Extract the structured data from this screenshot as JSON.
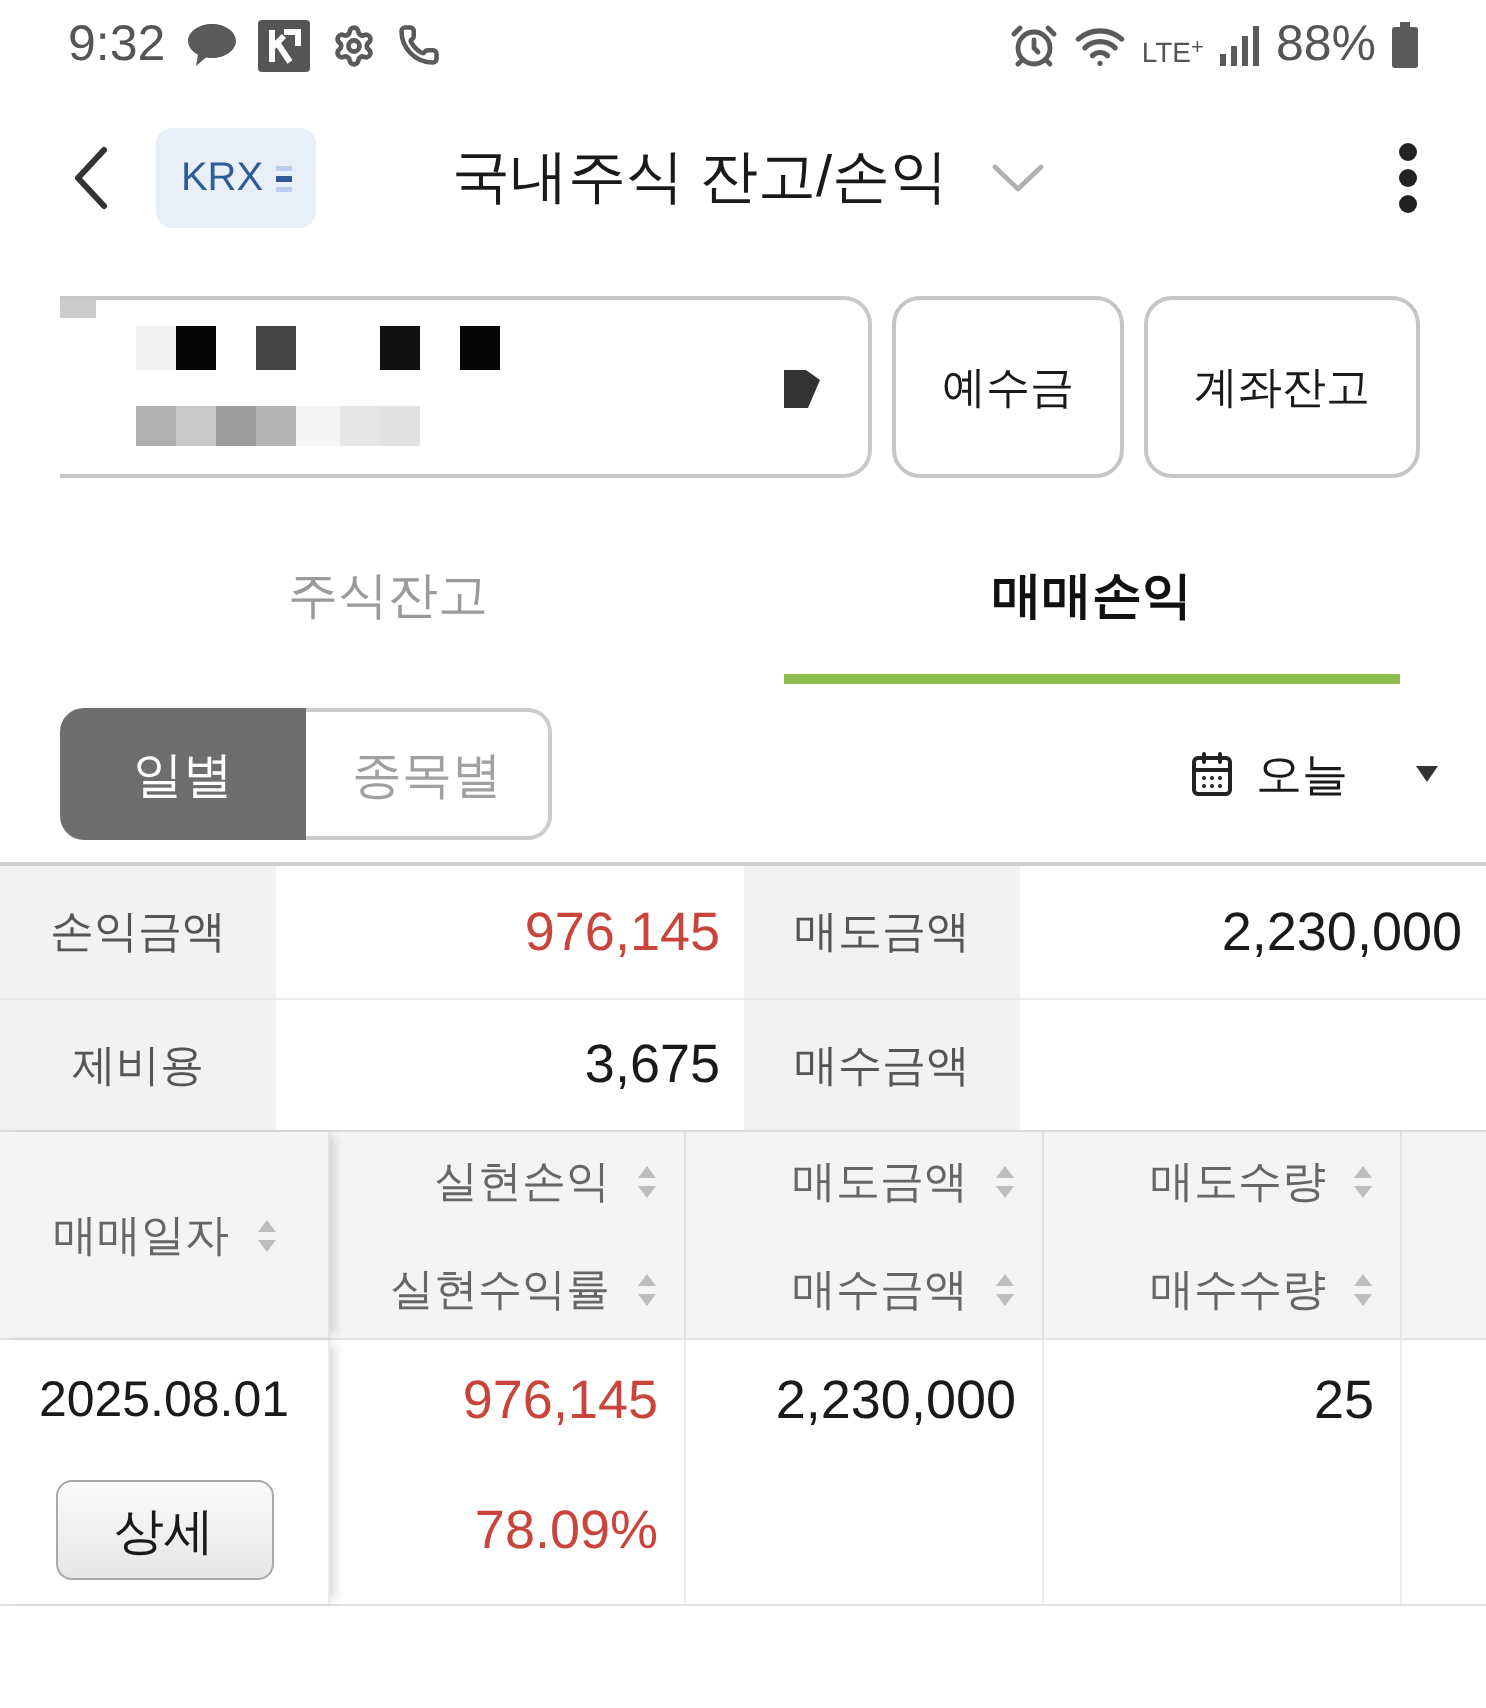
{
  "status_bar": {
    "time": "9:32",
    "network": "LTE$^{+}$",
    "battery": "88%"
  },
  "header": {
    "badge": "KRX",
    "title": "국내주식 잔고/손익"
  },
  "account_buttons": [
    "예수금",
    "계좌잔고"
  ],
  "tabs": [
    {
      "label": "주식잔고",
      "selected": false
    },
    {
      "label": "매매손익",
      "selected": true
    }
  ],
  "view_toggle": [
    {
      "label": "일별",
      "selected": true
    },
    {
      "label": "종목별",
      "selected": false
    }
  ],
  "date_filter": {
    "label": "오늘"
  },
  "summary": [
    {
      "label": "손익금액",
      "value": "976,145",
      "color": "#c9453b"
    },
    {
      "label": "매도금액",
      "value": "2,230,000",
      "color": "#1a1a1a"
    },
    {
      "label": "제비용",
      "value": "3,675",
      "color": "#1a1a1a"
    },
    {
      "label": "매수금액"
    }
  ],
  "table": {
    "columns": [
      {
        "lines": [
          "매매일자"
        ]
      },
      {
        "lines": [
          "실현손익",
          "실현수익률"
        ]
      },
      {
        "lines": [
          "매도금액",
          "매수금액"
        ]
      },
      {
        "lines": [
          "매도수량",
          "매수수량"
        ]
      }
    ],
    "rows": [
      {
        "cells": [
          {
            "lines": [
              "2025.08.01"
            ],
            "button": "상세",
            "color": "#1a1a1a"
          },
          {
            "lines": [
              "976,145",
              "78.09%"
            ],
            "color": "#c9453b"
          },
          {
            "lines": [
              "2,230,000"
            ],
            "color": "#1a1a1a"
          },
          {
            "lines": [
              "25"
            ],
            "color": "#1a1a1a"
          }
        ]
      }
    ]
  }
}
